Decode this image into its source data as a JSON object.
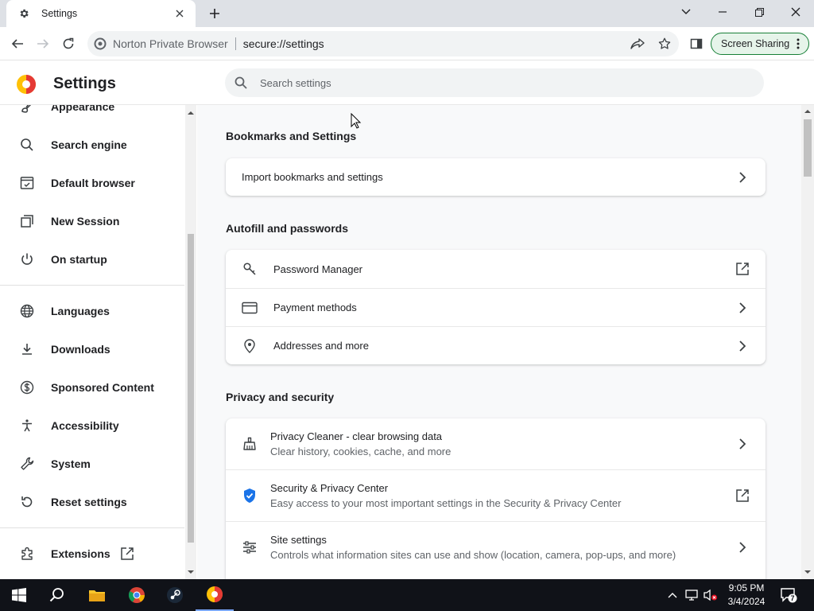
{
  "browser": {
    "tab_title": "Settings",
    "site_name": "Norton Private Browser",
    "url": "secure://settings",
    "screen_sharing_label": "Screen Sharing"
  },
  "header": {
    "title": "Settings",
    "search_placeholder": "Search settings"
  },
  "sidebar": {
    "items": [
      {
        "label": "Appearance",
        "icon": "paint-icon"
      },
      {
        "label": "Search engine",
        "icon": "search-icon"
      },
      {
        "label": "Default browser",
        "icon": "browser-icon"
      },
      {
        "label": "New Session",
        "icon": "new-session-icon"
      },
      {
        "label": "On startup",
        "icon": "power-icon"
      },
      {
        "label": "Languages",
        "icon": "globe-icon"
      },
      {
        "label": "Downloads",
        "icon": "download-icon"
      },
      {
        "label": "Sponsored Content",
        "icon": "dollar-icon"
      },
      {
        "label": "Accessibility",
        "icon": "accessibility-icon"
      },
      {
        "label": "System",
        "icon": "wrench-icon"
      },
      {
        "label": "Reset settings",
        "icon": "reset-icon"
      },
      {
        "label": "Extensions",
        "icon": "puzzle-icon"
      }
    ]
  },
  "sections": {
    "bookmarks": {
      "title": "Bookmarks and Settings",
      "rows": [
        {
          "label": "Import bookmarks and settings"
        }
      ]
    },
    "autofill": {
      "title": "Autofill and passwords",
      "rows": [
        {
          "label": "Password Manager",
          "icon": "key-icon",
          "action": "external-link-icon"
        },
        {
          "label": "Payment methods",
          "icon": "credit-card-icon",
          "action": "chevron-right-icon"
        },
        {
          "label": "Addresses and more",
          "icon": "location-pin-icon",
          "action": "chevron-right-icon"
        }
      ]
    },
    "privacy": {
      "title": "Privacy and security",
      "rows": [
        {
          "label": "Privacy Cleaner - clear browsing data",
          "sub": "Clear history, cookies, cache, and more",
          "icon": "broom-icon",
          "action": "chevron-right-icon"
        },
        {
          "label": "Security & Privacy Center",
          "sub": "Easy access to your most important settings in the Security & Privacy Center",
          "icon": "shield-check-icon",
          "action": "external-link-icon"
        },
        {
          "label": "Site settings",
          "sub": "Controls what information sites can use and show (location, camera, pop-ups, and more)",
          "icon": "sliders-icon",
          "action": "chevron-right-icon"
        }
      ]
    }
  },
  "taskbar": {
    "time": "9:05 PM",
    "date": "3/4/2024",
    "notification_count": "7"
  },
  "colors": {
    "accent": "#1a73e8",
    "screen_sharing_border": "#188038",
    "taskbar": "#101218"
  }
}
